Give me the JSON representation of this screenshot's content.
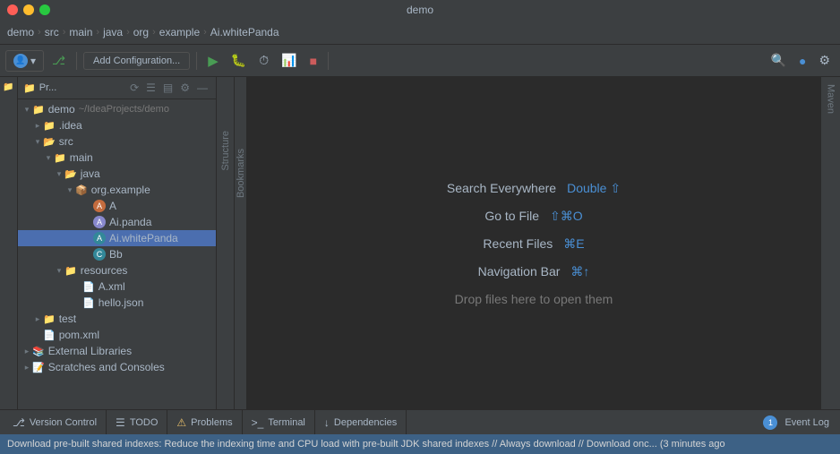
{
  "titleBar": {
    "title": "demo"
  },
  "breadcrumb": {
    "items": [
      "demo",
      "src",
      "main",
      "java",
      "org",
      "example",
      "Ai.whitePanda"
    ]
  },
  "toolbar": {
    "addConfigLabel": "Add Configuration...",
    "userLabel": "👤"
  },
  "projectPanel": {
    "title": "Pr...",
    "tree": [
      {
        "id": "demo",
        "label": "demo",
        "sub": "~/IdeaProjects/demo",
        "type": "root",
        "indent": 0,
        "open": true
      },
      {
        "id": "idea",
        "label": ".idea",
        "type": "folder",
        "indent": 1,
        "open": false
      },
      {
        "id": "src",
        "label": "src",
        "type": "src-folder",
        "indent": 1,
        "open": true
      },
      {
        "id": "main",
        "label": "main",
        "type": "folder",
        "indent": 2,
        "open": true
      },
      {
        "id": "java",
        "label": "java",
        "type": "java-folder",
        "indent": 3,
        "open": true
      },
      {
        "id": "org-example",
        "label": "org.example",
        "type": "package",
        "indent": 4,
        "open": true
      },
      {
        "id": "A",
        "label": "A",
        "type": "class-a",
        "indent": 5
      },
      {
        "id": "Ai-panda",
        "label": "Ai.panda",
        "type": "class-b",
        "indent": 5
      },
      {
        "id": "Ai-whitePanda",
        "label": "Ai.whitePanda",
        "type": "class-c",
        "indent": 5
      },
      {
        "id": "Bb",
        "label": "Bb",
        "type": "class-c",
        "indent": 5
      },
      {
        "id": "resources",
        "label": "resources",
        "type": "folder",
        "indent": 3,
        "open": true
      },
      {
        "id": "A-xml",
        "label": "A.xml",
        "type": "xml",
        "indent": 4
      },
      {
        "id": "hello-json",
        "label": "hello.json",
        "type": "json",
        "indent": 4
      },
      {
        "id": "test",
        "label": "test",
        "type": "folder",
        "indent": 1,
        "open": false
      },
      {
        "id": "pom-xml",
        "label": "pom.xml",
        "type": "pom",
        "indent": 1
      },
      {
        "id": "ext-libs",
        "label": "External Libraries",
        "type": "ext-lib",
        "indent": 0
      },
      {
        "id": "scratches",
        "label": "Scratches and Consoles",
        "type": "scratch",
        "indent": 0
      }
    ]
  },
  "editor": {
    "welcomeItems": [
      {
        "id": "search-everywhere",
        "label": "Search Everywhere",
        "shortcut": "Double ⇧",
        "shortcutType": "blue"
      },
      {
        "id": "go-to-file",
        "label": "Go to File",
        "shortcut": "⇧⌘O",
        "shortcutType": "blue"
      },
      {
        "id": "recent-files",
        "label": "Recent Files",
        "shortcut": "⌘E",
        "shortcutType": "blue"
      },
      {
        "id": "navigation-bar",
        "label": "Navigation Bar",
        "shortcut": "⌘↑",
        "shortcutType": "blue"
      },
      {
        "id": "drop-files",
        "label": "Drop files here to open them",
        "shortcut": "",
        "shortcutType": "plain"
      }
    ]
  },
  "rightTools": {
    "label": "Maven"
  },
  "structureSidebar": {
    "label": "Structure"
  },
  "bookmarksSidebar": {
    "label": "Bookmarks"
  },
  "bottomTabs": [
    {
      "id": "version-control",
      "icon": "⎇",
      "label": "Version Control"
    },
    {
      "id": "todo",
      "icon": "☰",
      "label": "TODO"
    },
    {
      "id": "problems",
      "icon": "⚠",
      "label": "Problems"
    },
    {
      "id": "terminal",
      "icon": ">_",
      "label": "Terminal"
    },
    {
      "id": "dependencies",
      "icon": "↓",
      "label": "Dependencies"
    }
  ],
  "bottomRight": {
    "eventBadge": "1",
    "eventLabel": "Event Log"
  },
  "statusBar": {
    "text": "Download pre-built shared indexes: Reduce the indexing time and CPU load with pre-built JDK shared indexes // Always download // Download onc... (3 minutes ago"
  }
}
